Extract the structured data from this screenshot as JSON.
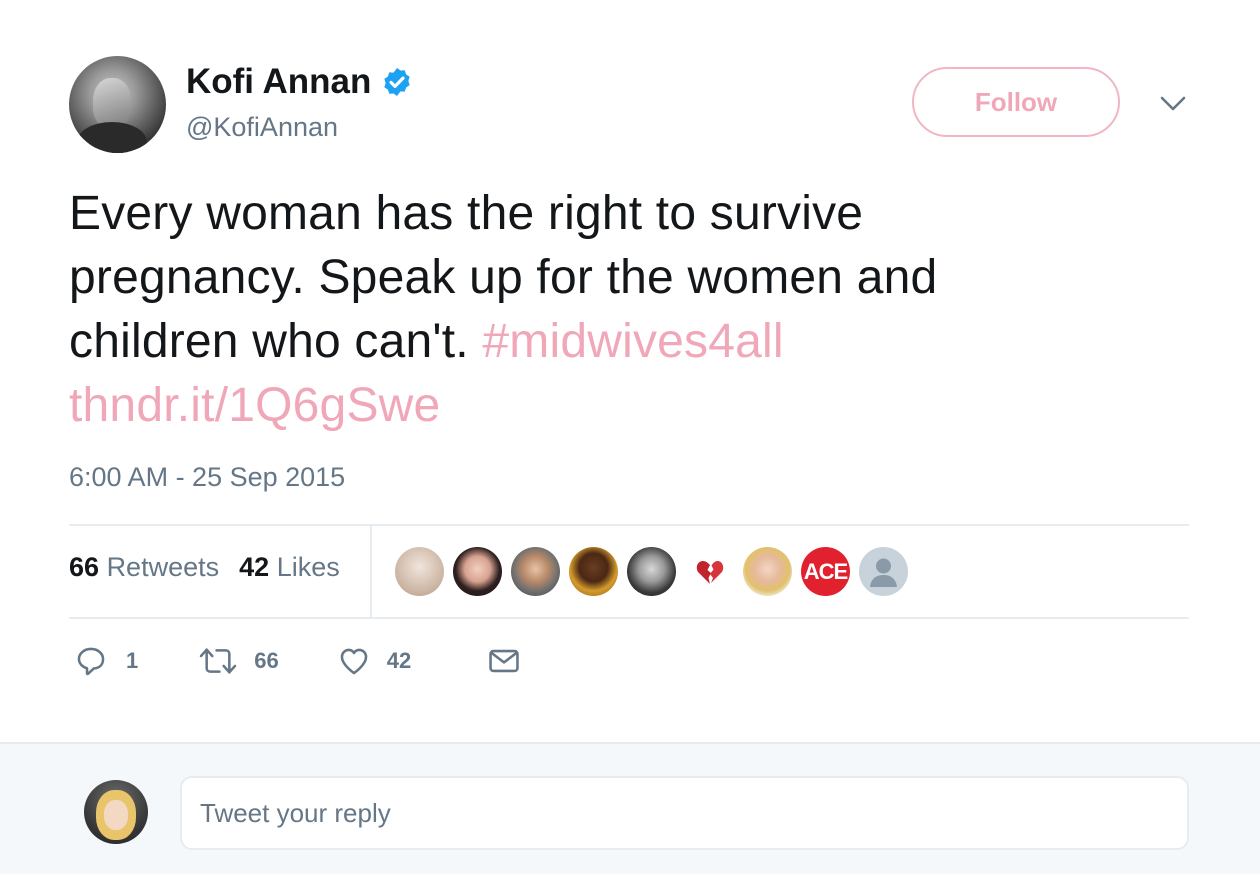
{
  "author": {
    "name": "Kofi Annan",
    "handle": "@KofiAnnan",
    "verified": true,
    "avatar": "author-avatar-photo"
  },
  "follow_button": {
    "label": "Follow"
  },
  "menu_icon": "chevron-down-icon",
  "tweet": {
    "lines": [
      {
        "text": "Every woman has the right to survive"
      },
      {
        "text": "pregnancy. Speak up for the women and"
      },
      {
        "text": "children who can't. ",
        "link": "#midwives4all"
      },
      {
        "link": "thndr.it/1Q6gSwe"
      }
    ],
    "timestamp": "6:00 AM - 25 Sep 2015"
  },
  "stats": {
    "retweets_count": "66",
    "retweets_label": "Retweets",
    "likes_count": "42",
    "likes_label": "Likes"
  },
  "likers": [
    "liker-avatar-1",
    "liker-avatar-2",
    "liker-avatar-3",
    "liker-avatar-4",
    "liker-avatar-5",
    "liker-avatar-6",
    "liker-avatar-7",
    "liker-avatar-8",
    "liker-avatar-9"
  ],
  "liker_badge_text": "ACE",
  "actions": {
    "reply_count": "1",
    "retweet_count": "66",
    "like_count": "42"
  },
  "reply_box": {
    "placeholder": "Tweet your reply"
  },
  "colors": {
    "accent_pink": "#f0a8b9",
    "verified_blue": "#1da1f2",
    "muted_text": "#657786",
    "border": "#e6ecf0"
  }
}
